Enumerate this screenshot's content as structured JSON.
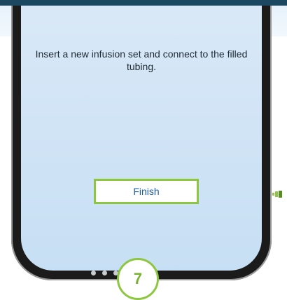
{
  "screen": {
    "instruction": "Insert a new infusion set and connect to the filled tubing.",
    "finish_label": "Finish",
    "pager": {
      "count": 6,
      "active_index": 5
    }
  },
  "step_number": "7",
  "icons": {
    "illustration": "infusion-set-illustration",
    "side": "battery-icon"
  },
  "colors": {
    "accent_green": "#8dc63f",
    "button_text": "#1e5ea8",
    "top_bar": "#1c4760"
  }
}
